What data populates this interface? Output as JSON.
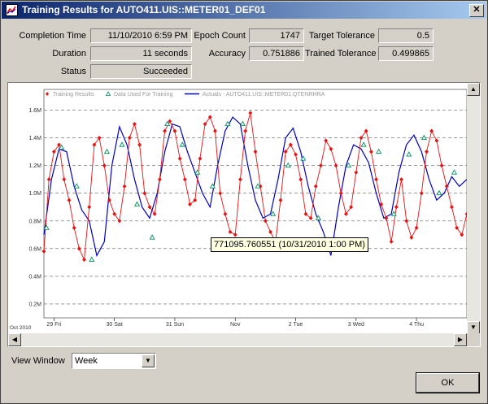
{
  "window": {
    "title": "Training Results for AUTO411.UIS::METER01_DEF01",
    "close_glyph": "✕"
  },
  "stats": {
    "completion_time_label": "Completion Time",
    "completion_time": "11/10/2010 6:59 PM",
    "duration_label": "Duration",
    "duration": "11 seconds",
    "status_label": "Status",
    "status": "Succeeded",
    "epoch_count_label": "Epoch Count",
    "epoch_count": "1747",
    "accuracy_label": "Accuracy",
    "accuracy": "0.751886",
    "target_tolerance_label": "Target Tolerance",
    "target_tolerance": "0.5",
    "trained_tolerance_label": "Trained Tolerance",
    "trained_tolerance": "0.499865"
  },
  "chart_data": {
    "type": "line",
    "legend": [
      "Training Results",
      "Data Used For Training",
      "Actuals - AUTO411.UIS::METER01.QTENRHRA"
    ],
    "y_ticks": [
      "1.6M",
      "1.4M",
      "1.2M",
      "1.0M",
      "0.8M",
      "0.6M",
      "0.4M",
      "0.2M"
    ],
    "y_tick_values": [
      1.6,
      1.4,
      1.2,
      1.0,
      0.8,
      0.6,
      0.4,
      0.2
    ],
    "ylim": [
      0.1,
      1.75
    ],
    "x_ticks": [
      "29 Fri",
      "30 Sat",
      "31 Sun",
      "Nov",
      "2 Tue",
      "3 Wed",
      "4 Thu"
    ],
    "x_corner_label": "Oct 2010",
    "grid": true,
    "series": [
      {
        "name": "Actuals - AUTO411.UIS::METER01.QTENRHRA",
        "color": "#0000c0",
        "x": [
          0,
          3,
          6,
          9,
          12,
          15,
          18,
          21,
          24,
          27,
          30,
          33,
          36,
          39,
          42,
          45,
          48,
          51,
          54,
          57,
          60,
          63,
          66,
          69,
          72,
          75,
          78,
          81,
          84,
          87,
          90,
          93,
          96,
          99,
          102,
          105,
          108,
          111,
          114,
          117,
          120,
          123,
          126,
          129,
          132,
          135,
          138,
          141,
          144,
          147,
          150,
          153,
          156,
          159,
          162,
          165,
          168
        ],
        "values": [
          0.7,
          1.1,
          1.32,
          1.3,
          1.05,
          0.88,
          0.8,
          0.55,
          0.65,
          1.2,
          1.48,
          1.35,
          1.1,
          0.9,
          0.82,
          1.0,
          1.3,
          1.5,
          1.48,
          1.3,
          1.15,
          1.0,
          0.9,
          1.2,
          1.45,
          1.55,
          1.5,
          1.2,
          0.95,
          0.82,
          0.85,
          1.1,
          1.4,
          1.47,
          1.3,
          1.05,
          0.85,
          0.72,
          0.55,
          0.9,
          1.2,
          1.35,
          1.32,
          1.22,
          1.0,
          0.82,
          0.85,
          1.15,
          1.35,
          1.42,
          1.3,
          1.1,
          0.95,
          1.0,
          1.12,
          1.05,
          1.1
        ]
      },
      {
        "name": "Training Results",
        "color": "#e81010",
        "x": [
          0,
          2,
          4,
          6,
          8,
          10,
          12,
          14,
          16,
          18,
          20,
          22,
          24,
          26,
          28,
          30,
          32,
          34,
          36,
          38,
          40,
          42,
          44,
          46,
          48,
          50,
          52,
          54,
          56,
          58,
          60,
          62,
          64,
          66,
          68,
          70,
          72,
          74,
          76,
          78,
          80,
          82,
          84,
          86,
          88,
          90,
          92,
          94,
          96,
          98,
          100,
          102,
          104,
          106,
          108,
          110,
          112,
          114,
          116,
          118,
          120,
          122,
          124,
          126,
          128,
          130,
          132,
          134,
          136,
          138,
          140,
          142,
          144,
          146,
          148,
          150,
          152,
          154,
          156,
          158,
          160,
          162,
          164,
          166,
          168
        ],
        "values": [
          0.58,
          1.1,
          1.3,
          1.35,
          1.1,
          0.95,
          0.75,
          0.6,
          0.52,
          0.9,
          1.35,
          1.4,
          1.2,
          0.95,
          0.85,
          0.8,
          1.05,
          1.4,
          1.5,
          1.35,
          1.0,
          0.9,
          0.85,
          1.1,
          1.45,
          1.52,
          1.45,
          1.25,
          1.1,
          0.92,
          0.95,
          1.25,
          1.5,
          1.55,
          1.45,
          1.0,
          0.85,
          0.72,
          0.7,
          1.1,
          1.45,
          1.58,
          1.3,
          1.05,
          0.8,
          0.72,
          0.65,
          0.95,
          1.3,
          1.35,
          1.28,
          1.1,
          0.85,
          0.82,
          1.05,
          1.2,
          1.38,
          1.32,
          1.2,
          1.0,
          0.85,
          0.9,
          1.15,
          1.4,
          1.45,
          1.3,
          1.1,
          0.92,
          0.82,
          0.65,
          0.9,
          1.1,
          0.8,
          0.68,
          0.75,
          1.0,
          1.3,
          1.45,
          1.38,
          1.2,
          1.05,
          0.9,
          0.75,
          0.7,
          0.85
        ]
      },
      {
        "name": "Data Used For Training",
        "color": "#009060",
        "x": [
          1,
          7,
          13,
          19,
          25,
          31,
          37,
          43,
          49,
          55,
          61,
          67,
          73,
          79,
          85,
          91,
          97,
          103,
          109,
          115,
          121,
          127,
          133,
          139,
          145,
          151,
          157,
          163
        ],
        "values": [
          0.75,
          1.33,
          1.05,
          0.52,
          1.3,
          1.35,
          0.92,
          0.68,
          1.5,
          1.35,
          1.15,
          1.05,
          1.5,
          1.5,
          1.05,
          0.85,
          1.2,
          1.25,
          0.82,
          0.6,
          1.2,
          1.35,
          1.3,
          0.85,
          1.28,
          1.4,
          1.0,
          1.15
        ]
      }
    ]
  },
  "tooltip": "771095.760551 (10/31/2010 1:00 PM)",
  "view_window": {
    "label": "View Window",
    "value": "Week"
  },
  "ok_label": "OK"
}
